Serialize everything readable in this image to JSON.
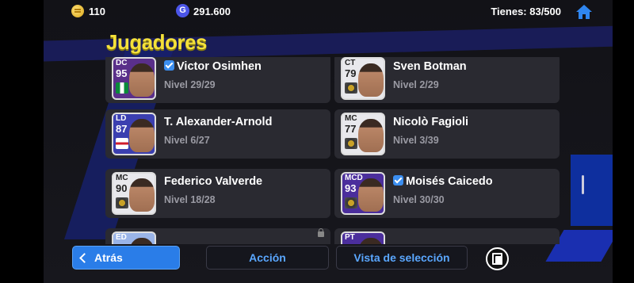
{
  "header": {
    "coins": "110",
    "gp": "291.600",
    "gp_symbol": "G",
    "tienes": "Tienes: 83/500"
  },
  "title": "Jugadores",
  "players": [
    {
      "pos": "DC",
      "rating": "95",
      "name": "Victor Osimhen",
      "level": "Nivel 29/29",
      "verified": true,
      "thumb_color": "#5a2f8a",
      "badge": "nigeria-flag"
    },
    {
      "pos": "CT",
      "rating": "79",
      "name": "Sven Botman",
      "level": "Nivel 2/29",
      "verified": false,
      "thumb_color": "#e8e8ec",
      "badge": "club-badge"
    },
    {
      "pos": "LD",
      "rating": "87",
      "name": "T. Alexander-Arnold",
      "level": "Nivel 6/27",
      "verified": false,
      "thumb_color": "#3b3fb0",
      "badge": "england-flag"
    },
    {
      "pos": "MC",
      "rating": "77",
      "name": "Nicolò Fagioli",
      "level": "Nivel 3/39",
      "verified": false,
      "thumb_color": "#e8e8ec",
      "badge": "club-badge"
    },
    {
      "pos": "MC",
      "rating": "90",
      "name": "Federico Valverde",
      "level": "Nivel 18/28",
      "verified": false,
      "thumb_color": "#e8e8ec",
      "badge": "club-badge"
    },
    {
      "pos": "MCD",
      "rating": "93",
      "name": "Moisés Caicedo",
      "level": "Nivel 30/30",
      "verified": true,
      "thumb_color": "#4b2e9c",
      "badge": "club-badge"
    },
    {
      "pos": "ED",
      "rating": "",
      "name": "",
      "level": "",
      "verified": false,
      "thumb_color": "#9ab4e8",
      "badge": "",
      "locked": true
    },
    {
      "pos": "PT",
      "rating": "",
      "name": "",
      "level": "",
      "verified": false,
      "thumb_color": "#4b2e9c",
      "badge": ""
    }
  ],
  "buttons": {
    "back": "Atrás",
    "accion": "Acción",
    "vista": "Vista de selección"
  },
  "colors": {
    "accent": "#2a7de8",
    "title": "#f4e13a",
    "link": "#5aa7ff"
  }
}
